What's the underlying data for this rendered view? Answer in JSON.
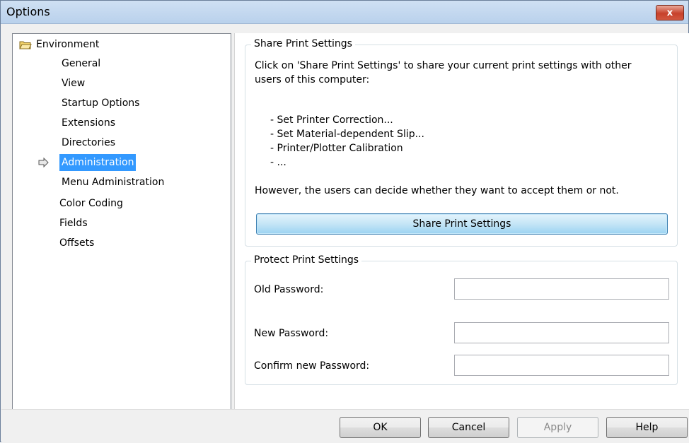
{
  "window": {
    "title": "Options",
    "close_glyph": "x"
  },
  "tree": {
    "root": {
      "label": "Environment",
      "icon": "folder-open-icon"
    },
    "items": [
      {
        "label": "General"
      },
      {
        "label": "View"
      },
      {
        "label": "Startup Options"
      },
      {
        "label": "Extensions"
      },
      {
        "label": "Directories"
      },
      {
        "label": "Administration",
        "selected": true
      },
      {
        "label": "Menu Administration"
      },
      {
        "label": "Color Coding"
      },
      {
        "label": "Fields"
      },
      {
        "label": "Offsets"
      }
    ]
  },
  "share": {
    "legend": "Share Print Settings",
    "intro_line1": "Click on 'Share Print Settings' to share your current print settings with other",
    "intro_line2": "users of this computer:",
    "bullets": [
      "- Set Printer Correction...",
      "- Set Material-dependent Slip...",
      "- Printer/Plotter Calibration",
      "- ..."
    ],
    "note": "However, the users can decide whether they want to accept them or not.",
    "button_label": "Share Print Settings"
  },
  "protect": {
    "legend": "Protect Print Settings",
    "old_password_label": "Old Password:",
    "old_password_value": "",
    "new_password_label": "New Password:",
    "new_password_value": "",
    "confirm_password_label": "Confirm new Password:",
    "confirm_password_value": ""
  },
  "buttons": {
    "ok": "OK",
    "cancel": "Cancel",
    "apply": "Apply",
    "help": "Help"
  },
  "colors": {
    "selection": "#3399ff",
    "share_button": "#c4e5f6"
  }
}
